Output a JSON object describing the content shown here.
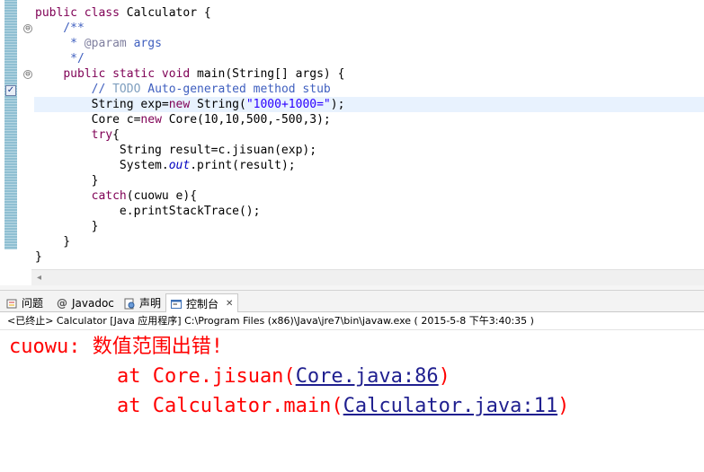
{
  "editor": {
    "lines": [
      {
        "kind": "class",
        "kw": "public class ",
        "rest": "Calculator {"
      },
      {
        "kind": "comment",
        "text": "    /**"
      },
      {
        "kind": "param",
        "prefix": "     * ",
        "tag": "@param",
        "rest": " args"
      },
      {
        "kind": "comment",
        "text": "     */"
      },
      {
        "kind": "method",
        "indent": "    ",
        "kw": "public static void ",
        "rest": "main(String[] args) {"
      },
      {
        "kind": "todo",
        "indent": "        ",
        "slashes": "// ",
        "todo": "TODO",
        "rest": " Auto-generated method stub"
      },
      {
        "kind": "strdecl",
        "indent": "        ",
        "a": "String exp=",
        "kw": "new",
        "b": " String(",
        "str": "\"1000+1000=\"",
        "c": ");"
      },
      {
        "kind": "newdecl",
        "indent": "        ",
        "a": "Core c=",
        "kw": "new",
        "b": " Core(10,10,500,-500,3);"
      },
      {
        "kind": "kwline",
        "indent": "        ",
        "kw": "try",
        "rest": "{"
      },
      {
        "kind": "plain",
        "text": "            String result=c.jisuan(exp);"
      },
      {
        "kind": "out",
        "indent": "            ",
        "a": "System.",
        "ital": "out",
        "b": ".print(result);"
      },
      {
        "kind": "plain",
        "text": "        }"
      },
      {
        "kind": "kwline",
        "indent": "        ",
        "kw": "catch",
        "rest": "(cuowu e){"
      },
      {
        "kind": "plain",
        "text": "            e.printStackTrace();"
      },
      {
        "kind": "plain",
        "text": "        }"
      },
      {
        "kind": "plain",
        "text": "    }"
      },
      {
        "kind": "plain",
        "text": "}"
      }
    ],
    "fold_glyph": "⊖",
    "task_glyph": "✓",
    "scroll_left_glyph": "◂"
  },
  "tabs": [
    {
      "label": "问题",
      "icon": "problems-icon",
      "active": false
    },
    {
      "label": "Javadoc",
      "icon": "javadoc-at-icon",
      "glyph": "@",
      "active": false
    },
    {
      "label": "声明",
      "icon": "declaration-icon",
      "active": false
    },
    {
      "label": "控制台",
      "icon": "console-icon",
      "active": true,
      "close": "✕"
    }
  ],
  "console": {
    "header": "<已终止> Calculator [Java 应用程序] C:\\Program Files (x86)\\Java\\jre7\\bin\\javaw.exe ( 2015-5-8 下午3:40:35 )",
    "line1": "cuowu: 数值范围出错!",
    "trace": [
      {
        "prefix": "at Core.jisuan(",
        "link": "Core.java:86",
        "suffix": ")"
      },
      {
        "prefix": "at Calculator.main(",
        "link": "Calculator.java:11",
        "suffix": ")"
      }
    ]
  },
  "colors": {
    "keyword": "#7f0055",
    "comment": "#3f5fbf",
    "string": "#2a00ff",
    "error": "#ff0000",
    "current_line": "#e8f2fe"
  }
}
